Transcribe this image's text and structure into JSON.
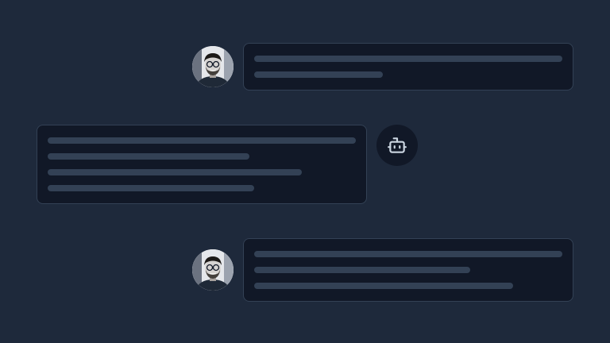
{
  "conversation": {
    "messages": [
      {
        "role": "user",
        "avatar_icon": "user-photo-avatar",
        "placeholder_lines": 2
      },
      {
        "role": "assistant",
        "avatar_icon": "robot-icon",
        "placeholder_lines": 4
      },
      {
        "role": "user",
        "avatar_icon": "user-photo-avatar",
        "placeholder_lines": 3
      }
    ]
  },
  "colors": {
    "background": "#1e293b",
    "bubble": "#111827",
    "bubble_border": "#334155",
    "skeleton_line": "#334155",
    "bot_icon": "#cbd5e1"
  }
}
